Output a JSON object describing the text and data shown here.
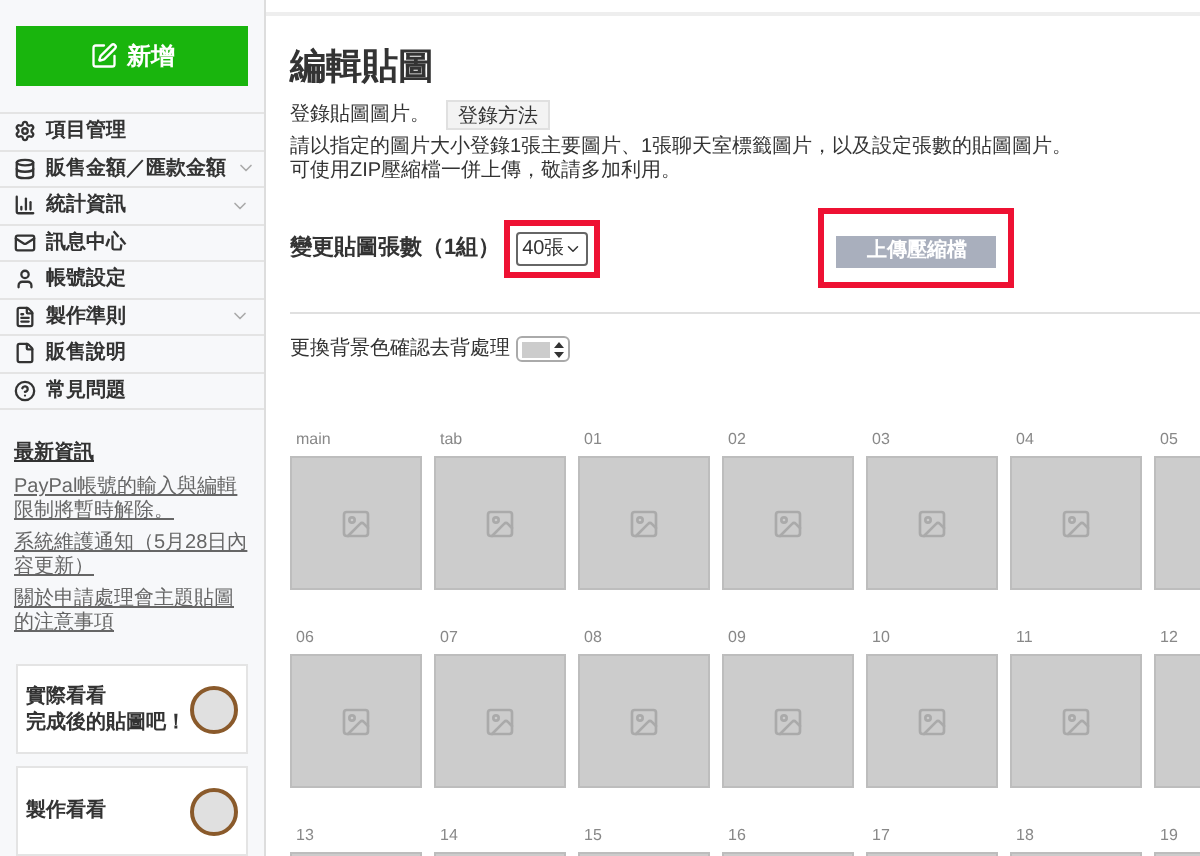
{
  "sidebar": {
    "new_button": "新增",
    "items": [
      {
        "label": "項目管理",
        "expandable": false
      },
      {
        "label": "販售金額／匯款金額",
        "expandable": true
      },
      {
        "label": "統計資訊",
        "expandable": true
      },
      {
        "label": "訊息中心",
        "expandable": false
      },
      {
        "label": "帳號設定",
        "expandable": false
      },
      {
        "label": "製作準則",
        "expandable": true
      },
      {
        "label": "販售說明",
        "expandable": false
      },
      {
        "label": "常見問題",
        "expandable": false
      }
    ],
    "news": {
      "title": "最新資訊",
      "links": [
        "PayPal帳號的輸入與編輯限制將暫時解除。",
        "系統維護通知（5月28日內容更新）",
        "關於申請處理會主題貼圖的注意事項"
      ]
    },
    "promos": [
      {
        "lines": [
          "實際看看",
          "完成後的貼圖吧！"
        ]
      },
      {
        "lines": [
          "製作看看"
        ]
      }
    ]
  },
  "main": {
    "title": "編輯貼圖",
    "register_label": "登錄貼圖圖片。",
    "register_button": "登錄方法",
    "description": [
      "請以指定的圖片大小登錄1張主要圖片、1張聊天室標籤圖片，以及設定張數的貼圖圖片。",
      "可使用ZIP壓縮檔一併上傳，敬請多加利用。"
    ],
    "count_label": "變更貼圖張數（1組）",
    "count_select": "40張",
    "upload_button": {
      "label": "上傳壓縮檔",
      "disabled": true
    },
    "background_label": "更換背景色確認去背處理",
    "tile_rows": [
      [
        "main",
        "tab",
        "01",
        "02",
        "03",
        "04",
        "05"
      ],
      [
        "06",
        "07",
        "08",
        "09",
        "10",
        "11",
        "12"
      ],
      [
        "13",
        "14",
        "15",
        "16",
        "17",
        "18",
        "19"
      ]
    ]
  }
}
